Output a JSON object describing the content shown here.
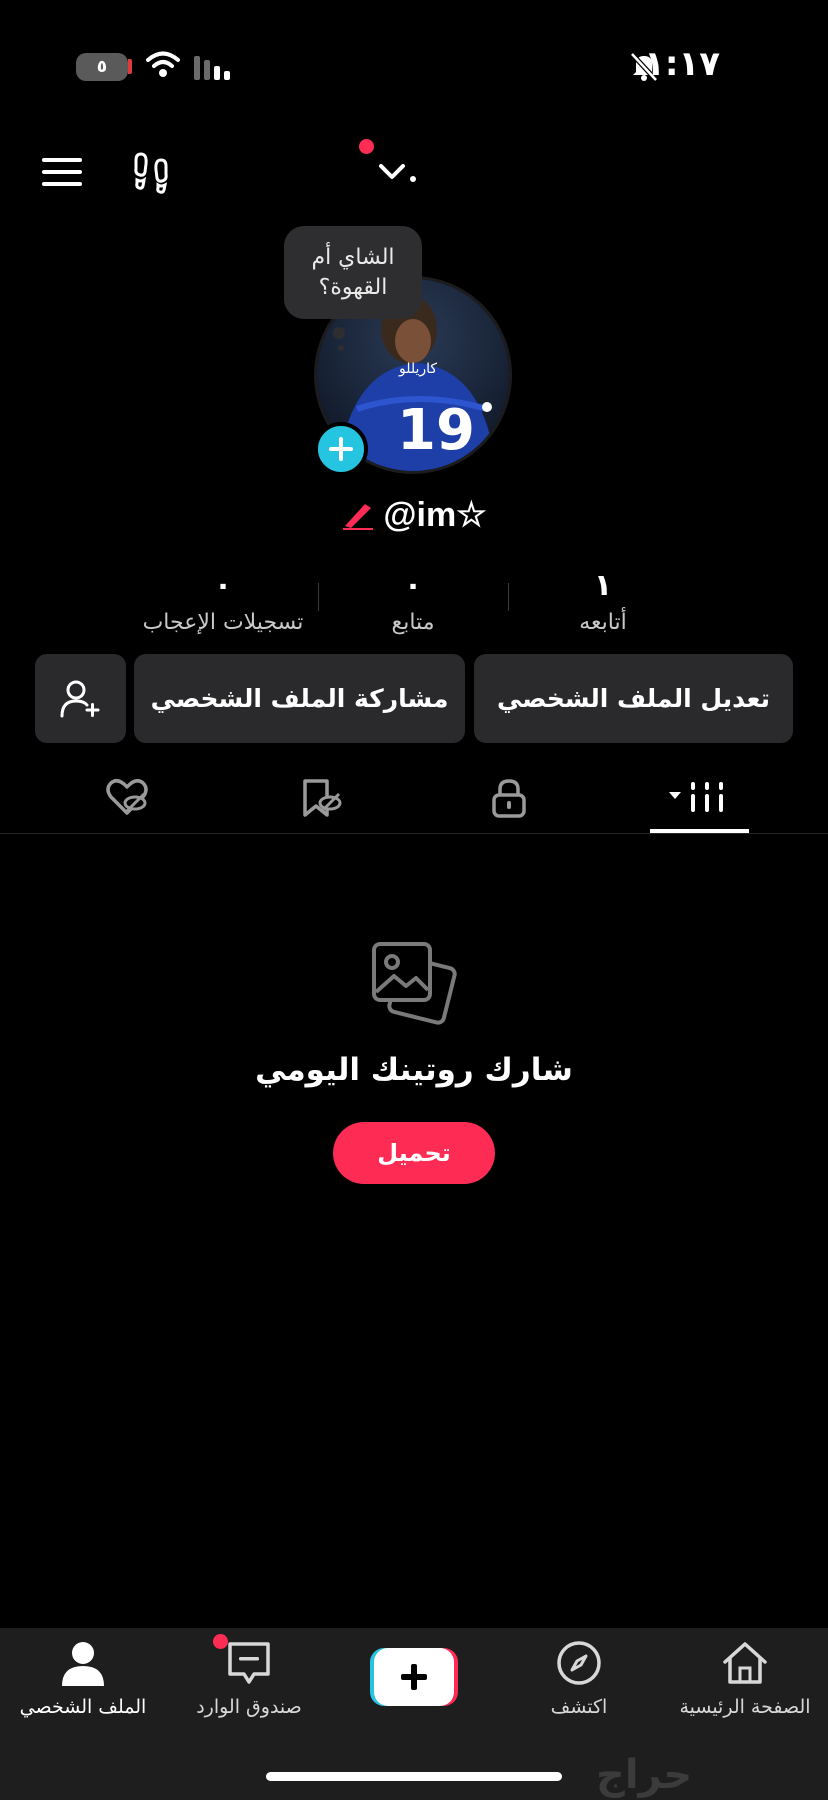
{
  "status_bar": {
    "battery_level": "٥",
    "time": "١:١٧"
  },
  "profile": {
    "note_bubble": "الشاي أم القهوة؟",
    "jersey_name": "كاريللو",
    "jersey_number": "19",
    "username": "@im☆"
  },
  "stats": [
    {
      "value": "١",
      "label": "أتابعه"
    },
    {
      "value": "٠",
      "label": "متابع"
    },
    {
      "value": "٠",
      "label": "تسجيلات الإعجاب"
    }
  ],
  "actions": {
    "edit_profile": "تعديل الملف الشخصي",
    "share_profile": "مشاركة الملف الشخصي"
  },
  "tabs": {
    "active": "videos"
  },
  "empty_state": {
    "title": "شارك روتينك اليومي",
    "upload_label": "تحميل"
  },
  "bottom_nav": [
    {
      "id": "home",
      "label": "الصفحة الرئيسية"
    },
    {
      "id": "discover",
      "label": "اكتشف"
    },
    {
      "id": "create",
      "label": ""
    },
    {
      "id": "inbox",
      "label": "صندوق الوارد"
    },
    {
      "id": "profile",
      "label": "الملف الشخصي"
    }
  ],
  "watermark": "حراج",
  "colors": {
    "accent": "#fe2c55",
    "cyan": "#25c4e0",
    "surface": "#2a2a2c"
  }
}
